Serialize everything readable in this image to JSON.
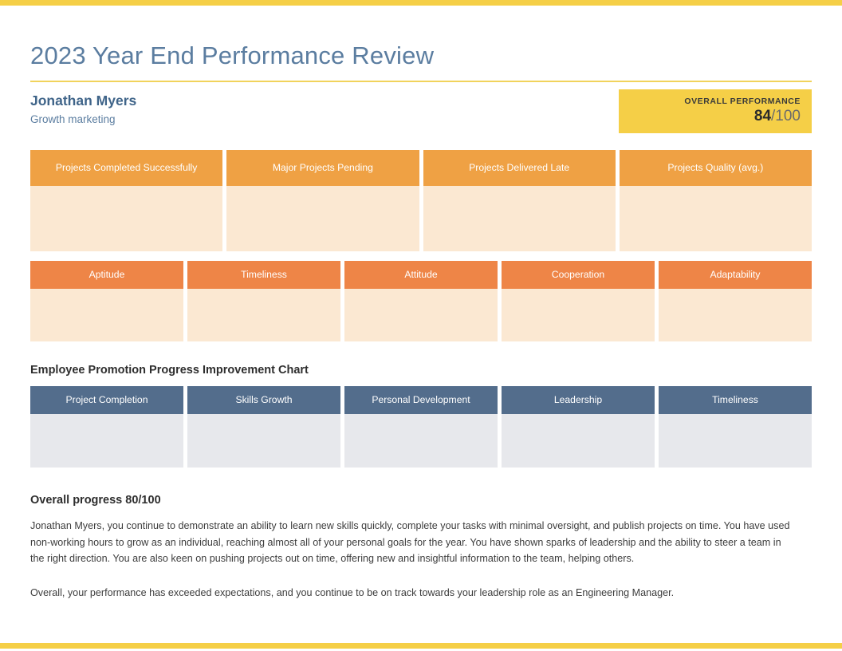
{
  "colors": {
    "accent_bar": "#f5cf47",
    "title_text": "#5b7da0",
    "title_rule": "#f1d35c",
    "score_card_bg": "#f5cf47",
    "project_header": "#efa144",
    "project_body": "#fbe8d2",
    "trait_header": "#ee8547",
    "trait_body": "#fbe8d2",
    "promotion_header": "#536d8c",
    "promotion_body": "#e7e8ec"
  },
  "header": {
    "title": "2023 Year End Performance Review"
  },
  "employee": {
    "name": "Jonathan Myers",
    "role": "Growth marketing"
  },
  "overall_performance": {
    "label": "OVERALL PERFORMANCE",
    "score": "84",
    "out_of": "/100"
  },
  "project_metrics": {
    "cards": [
      {
        "label": "Projects Completed Successfully",
        "value": ""
      },
      {
        "label": "Major Projects Pending",
        "value": ""
      },
      {
        "label": "Projects Delivered Late",
        "value": ""
      },
      {
        "label": "Projects Quality (avg.)",
        "value": ""
      }
    ]
  },
  "trait_metrics": {
    "cards": [
      {
        "label": "Aptitude",
        "value": ""
      },
      {
        "label": "Timeliness",
        "value": ""
      },
      {
        "label": "Attitude",
        "value": ""
      },
      {
        "label": "Cooperation",
        "value": ""
      },
      {
        "label": "Adaptability",
        "value": ""
      }
    ]
  },
  "promotion_chart": {
    "heading": "Employee Promotion Progress Improvement Chart",
    "cards": [
      {
        "label": "Project Completion",
        "value": ""
      },
      {
        "label": "Skills Growth",
        "value": ""
      },
      {
        "label": "Personal Development",
        "value": ""
      },
      {
        "label": "Leadership",
        "value": ""
      },
      {
        "label": "Timeliness",
        "value": ""
      }
    ]
  },
  "summary": {
    "heading": "Overall progress 80/100",
    "paragraph_1": "Jonathan Myers, you continue to demonstrate an ability to learn new skills quickly, complete your tasks with minimal oversight, and publish projects on time. You have used non-working hours to grow as an individual, reaching almost all of your personal goals for the year. You have shown sparks of leadership and the ability to steer a team in the right direction. You are also keen on pushing projects out on time, offering new and insightful information to the team, helping others.",
    "paragraph_2": "Overall, your performance has exceeded expectations, and you continue to be on track towards your leadership role as an Engineering Manager."
  },
  "chart_data": {
    "type": "bar",
    "title": "Employee Promotion Progress Improvement Chart",
    "categories": [
      "Project Completion",
      "Skills Growth",
      "Personal Development",
      "Leadership",
      "Timeliness"
    ],
    "values": [
      null,
      null,
      null,
      null,
      null
    ],
    "xlabel": "",
    "ylabel": "",
    "ylim": [
      0,
      100
    ]
  }
}
